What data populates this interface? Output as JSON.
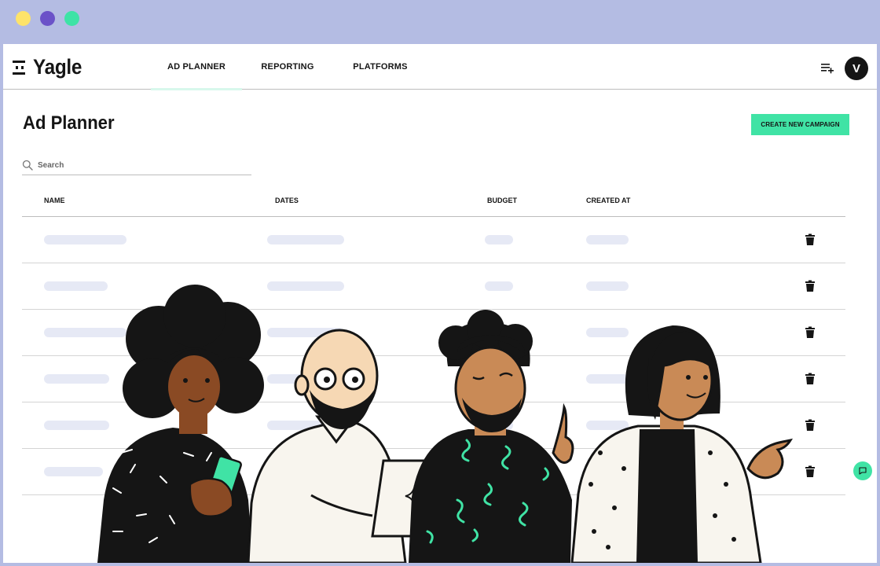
{
  "window_controls": {
    "colors": [
      "#fde36a",
      "#6b52c8",
      "#3ee3a6"
    ]
  },
  "brand": {
    "name": "Yagle",
    "accent": "#40e3a5"
  },
  "nav": {
    "tabs": [
      {
        "label": "AD PLANNER",
        "active": true
      },
      {
        "label": "REPORTING",
        "active": false
      },
      {
        "label": "PLATFORMS",
        "active": false
      }
    ]
  },
  "header": {
    "queue_icon": "playlist-add-icon",
    "avatar_initial": "V"
  },
  "page": {
    "title": "Ad Planner",
    "create_button": "CREATE NEW CAMPAIGN"
  },
  "search": {
    "placeholder": "Search",
    "value": ""
  },
  "table": {
    "columns": [
      "NAME",
      "DATES",
      "BUDGET",
      "CREATED AT"
    ],
    "row_count": 6,
    "loading": true,
    "row_action_icon": "trash-icon"
  },
  "chat": {
    "icon": "chat-bubble-icon"
  },
  "illustration": {
    "subject": "four-people-illustration"
  }
}
